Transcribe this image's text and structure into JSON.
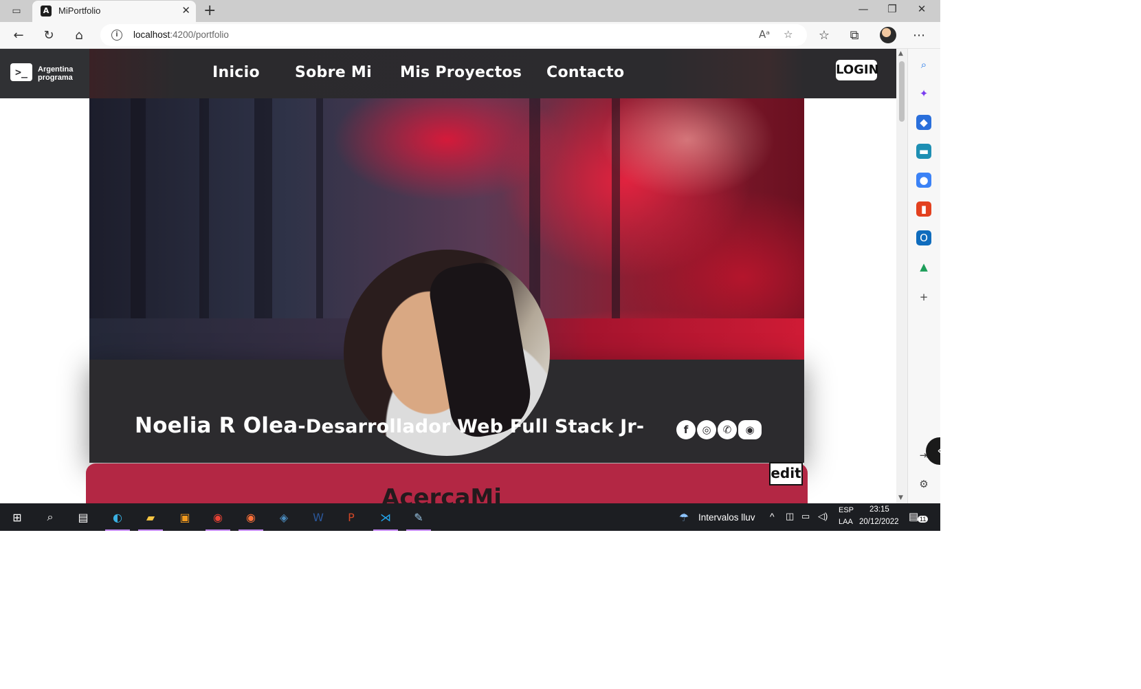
{
  "browser": {
    "tab_title": "MiPortfolio",
    "tab_favicon": "A",
    "url_host": "localhost",
    "url_path": ":4200/portfolio"
  },
  "site": {
    "brand_line1": "Argentina",
    "brand_line2": "programa",
    "brand_mark": ">_",
    "nav": [
      "Inicio",
      "Sobre Mi",
      "Mis Proyectos",
      "Contacto"
    ],
    "login_label": "LOGIN",
    "name": "Noelia R Olea",
    "role": "-Desarrollador Web Full Stack Jr-",
    "socials": [
      {
        "icon": "facebook-icon",
        "glyph": "f"
      },
      {
        "icon": "instagram-icon",
        "glyph": "◎"
      },
      {
        "icon": "whatsapp-icon",
        "glyph": "✆"
      },
      {
        "icon": "discord-icon",
        "glyph": "◉"
      }
    ],
    "edit_label": "edit",
    "about_title": "AcercaMi"
  },
  "taskbar": {
    "weather_text": "Intervalos lluv",
    "lang_line1": "ESP",
    "lang_line2": "LAA",
    "time": "23:15",
    "date": "20/12/2022",
    "notif_count": "11"
  }
}
